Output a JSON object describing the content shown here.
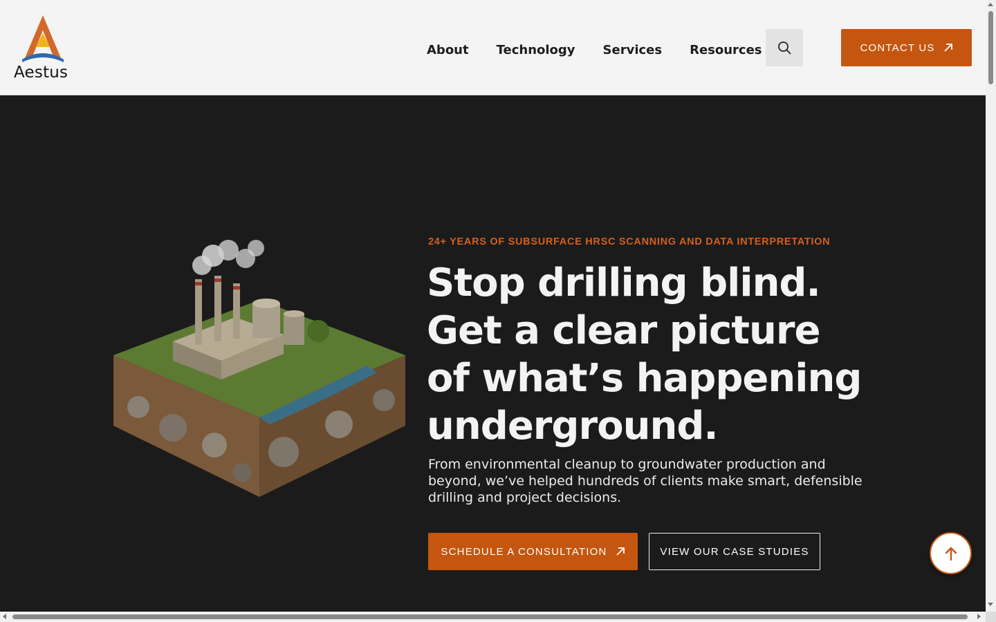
{
  "brand": {
    "name": "Aestus"
  },
  "nav": {
    "items": [
      "About",
      "Technology",
      "Services",
      "Resources"
    ],
    "contact_label": "CONTACT US"
  },
  "hero": {
    "eyebrow": "24+ YEARS OF SUBSURFACE HRSC SCANNING AND DATA INTERPRETATION",
    "headline": "Stop drilling blind. Get a clear picture of what’s happening underground.",
    "subtext": "From environmental cleanup to groundwater production and beyond, we’ve helped hundreds of clients make smart, defensible drilling and project decisions.",
    "primary_cta": "SCHEDULE A CONSULTATION",
    "secondary_cta": "VIEW OUR CASE STUDIES"
  },
  "colors": {
    "accent": "#c5560f",
    "hero_bg": "#1b1b1c",
    "header_bg": "#f4f4f4"
  },
  "icons": {
    "search": "search-icon",
    "external": "arrow-up-right-icon",
    "scroll_top": "arrow-up-icon"
  }
}
